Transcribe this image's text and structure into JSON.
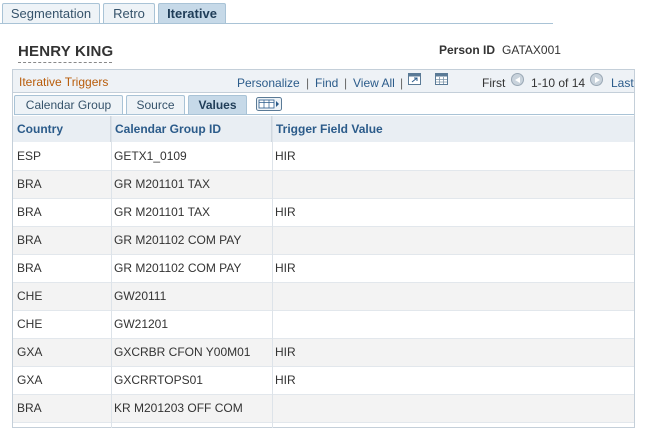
{
  "top_tabs": [
    {
      "label": "Segmentation",
      "active": false
    },
    {
      "label": "Retro",
      "active": false
    },
    {
      "label": "Iterative",
      "active": true
    }
  ],
  "person": {
    "name": "HENRY KING",
    "id_label": "Person ID",
    "id_value": "GATAX001"
  },
  "grid": {
    "title": "Iterative Triggers",
    "personalize": "Personalize",
    "find": "Find",
    "view_all": "View All",
    "separator": "|",
    "first": "First",
    "range": "1-10 of 14",
    "last": "Last"
  },
  "sub_tabs": [
    {
      "label": "Calendar Group",
      "active": false
    },
    {
      "label": "Source",
      "active": false
    },
    {
      "label": "Values",
      "active": true
    }
  ],
  "columns": [
    "Country",
    "Calendar Group ID",
    "Trigger Field Value"
  ],
  "rows": [
    {
      "country": "ESP",
      "group": "GETX1_0109",
      "trigger": "HIR"
    },
    {
      "country": "BRA",
      "group": "GR M201101 TAX",
      "trigger": ""
    },
    {
      "country": "BRA",
      "group": "GR M201101 TAX",
      "trigger": "HIR"
    },
    {
      "country": "BRA",
      "group": "GR M201102 COM PAY",
      "trigger": ""
    },
    {
      "country": "BRA",
      "group": "GR M201102 COM PAY",
      "trigger": "HIR"
    },
    {
      "country": "CHE",
      "group": "GW20111",
      "trigger": ""
    },
    {
      "country": "CHE",
      "group": "GW21201",
      "trigger": ""
    },
    {
      "country": "GXA",
      "group": "GXCRBR CFON Y00M01",
      "trigger": "HIR"
    },
    {
      "country": "GXA",
      "group": "GXCRRTOPS01",
      "trigger": "HIR"
    },
    {
      "country": "BRA",
      "group": "KR M201203 OFF COM",
      "trigger": ""
    }
  ],
  "colors": {
    "tab_active": "#c6d9e8",
    "link": "#2b5b8a",
    "grid_title": "#b85c0a"
  },
  "icons": [
    "zoom-grid-icon",
    "download-icon",
    "prev-arrow-icon",
    "next-arrow-icon",
    "show-all-columns-icon"
  ]
}
